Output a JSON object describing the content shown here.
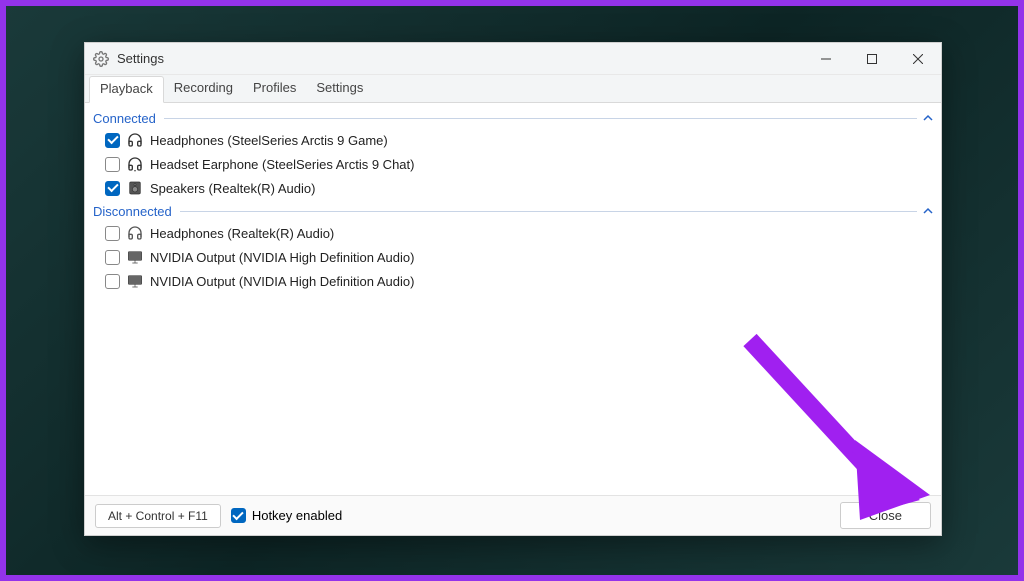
{
  "window": {
    "title": "Settings"
  },
  "tabs": {
    "playback": "Playback",
    "recording": "Recording",
    "profiles": "Profiles",
    "settings": "Settings"
  },
  "sections": {
    "connected": {
      "header": "Connected",
      "items": [
        {
          "checked": true,
          "icon": "headphones",
          "label": "Headphones (SteelSeries Arctis 9 Game)"
        },
        {
          "checked": false,
          "icon": "headset",
          "label": "Headset Earphone (SteelSeries Arctis 9 Chat)"
        },
        {
          "checked": true,
          "icon": "speaker",
          "label": "Speakers (Realtek(R) Audio)"
        }
      ]
    },
    "disconnected": {
      "header": "Disconnected",
      "items": [
        {
          "checked": false,
          "icon": "headphones",
          "label": "Headphones (Realtek(R) Audio)"
        },
        {
          "checked": false,
          "icon": "monitor",
          "label": "NVIDIA Output (NVIDIA High Definition Audio)"
        },
        {
          "checked": false,
          "icon": "monitor",
          "label": "NVIDIA Output (NVIDIA High Definition Audio)"
        }
      ]
    }
  },
  "footer": {
    "hotkey": "Alt + Control + F11",
    "hotkey_enabled_label": "Hotkey enabled",
    "hotkey_enabled_checked": true,
    "close_label": "Close"
  }
}
